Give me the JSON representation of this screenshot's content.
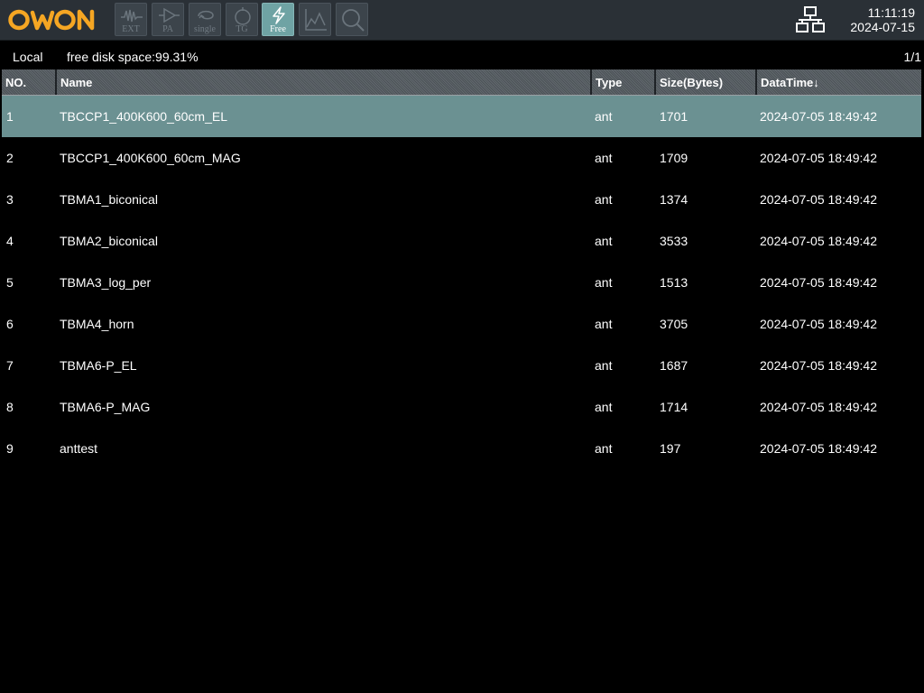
{
  "header": {
    "brand": "OWON",
    "tools": [
      {
        "label": "EXT",
        "icon": "waveform-icon",
        "active": false
      },
      {
        "label": "PA",
        "icon": "amplifier-icon",
        "active": false
      },
      {
        "label": "single",
        "icon": "single-sweep-icon",
        "active": false
      },
      {
        "label": "TG",
        "icon": "tracking-generator-icon",
        "active": false
      },
      {
        "label": "Free",
        "icon": "lightning-icon",
        "active": true
      },
      {
        "label": "",
        "icon": "chart-icon",
        "active": false
      },
      {
        "label": "",
        "icon": "magnifier-icon",
        "active": false
      }
    ],
    "network_icon": "network-icon",
    "time": "11:11:19",
    "date": "2024-07-15"
  },
  "status": {
    "location": "Local",
    "disk_space": "free disk space:99.31%",
    "page": "1/1"
  },
  "table": {
    "columns": [
      "NO.",
      "Name",
      "Type",
      "Size(Bytes)",
      "DataTime↓"
    ],
    "selected_index": 0,
    "rows": [
      {
        "no": "1",
        "name": "TBCCP1_400K600_60cm_EL",
        "type": "ant",
        "size": "1701",
        "datetime": "2024-07-05 18:49:42"
      },
      {
        "no": "2",
        "name": "TBCCP1_400K600_60cm_MAG",
        "type": "ant",
        "size": "1709",
        "datetime": "2024-07-05 18:49:42"
      },
      {
        "no": "3",
        "name": "TBMA1_biconical",
        "type": "ant",
        "size": "1374",
        "datetime": "2024-07-05 18:49:42"
      },
      {
        "no": "4",
        "name": "TBMA2_biconical",
        "type": "ant",
        "size": "3533",
        "datetime": "2024-07-05 18:49:42"
      },
      {
        "no": "5",
        "name": "TBMA3_log_per",
        "type": "ant",
        "size": "1513",
        "datetime": "2024-07-05 18:49:42"
      },
      {
        "no": "6",
        "name": "TBMA4_horn",
        "type": "ant",
        "size": "3705",
        "datetime": "2024-07-05 18:49:42"
      },
      {
        "no": "7",
        "name": "TBMA6-P_EL",
        "type": "ant",
        "size": "1687",
        "datetime": "2024-07-05 18:49:42"
      },
      {
        "no": "8",
        "name": "TBMA6-P_MAG",
        "type": "ant",
        "size": "1714",
        "datetime": "2024-07-05 18:49:42"
      },
      {
        "no": "9",
        "name": "anttest",
        "type": "ant",
        "size": "197",
        "datetime": "2024-07-05 18:49:42"
      }
    ]
  },
  "colors": {
    "brand": "#f5a623",
    "topbar": "#2a3036",
    "active_tool": "#6fa3a4",
    "selected_row": "#6b9192"
  }
}
